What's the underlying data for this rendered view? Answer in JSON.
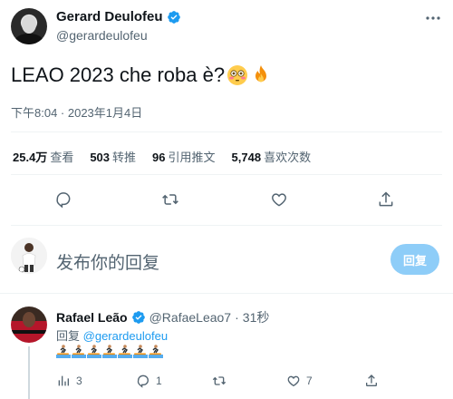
{
  "tweet": {
    "author_name": "Gerard Deulofeu",
    "author_handle": "@gerardeulofeu",
    "text": "LEAO 2023 che roba è?",
    "emojis": [
      "flushed-face",
      "fire"
    ],
    "timestamp": "下午8:04 · 2023年1月4日",
    "stats": {
      "views_value": "25.4万",
      "views_label": "查看",
      "retweets_value": "503",
      "retweets_label": "转推",
      "quotes_value": "96",
      "quotes_label": "引用推文",
      "likes_value": "5,748",
      "likes_label": "喜欢次数"
    },
    "actions": [
      "reply-icon",
      "retweet-icon",
      "like-icon",
      "share-icon"
    ]
  },
  "composer": {
    "placeholder": "发布你的回复",
    "button_label": "回复"
  },
  "reply": {
    "author_name": "Rafael Leão",
    "author_handle": "@RafaeLeao7",
    "time": "31秒",
    "reply_prefix": "回复",
    "reply_to": "@gerardeulofeu",
    "emoji_count": 7,
    "emoji": "person-surfing",
    "actions": {
      "views": "3",
      "replies": "1",
      "retweets": "",
      "likes": "7"
    }
  },
  "colors": {
    "accent": "#1d9bf0",
    "button_disabled": "#8ecdf8",
    "secondary_text": "#536471"
  }
}
